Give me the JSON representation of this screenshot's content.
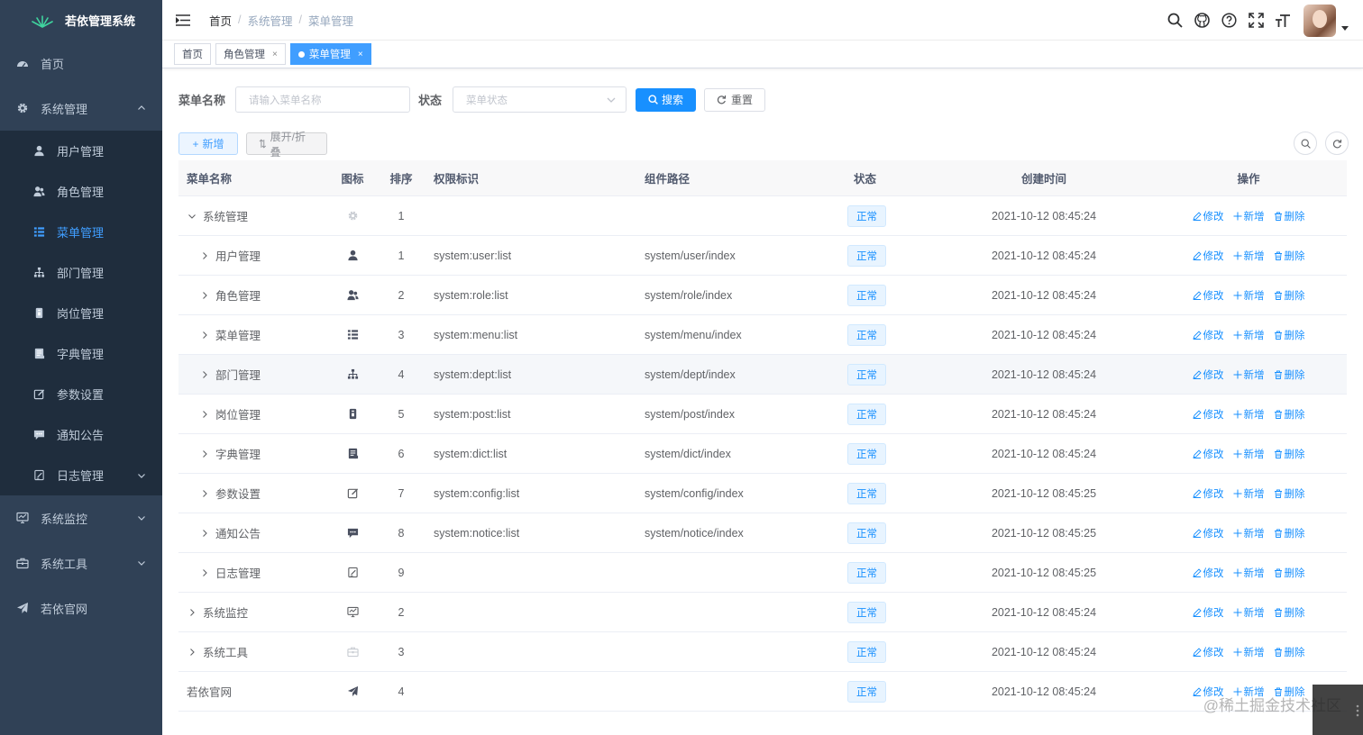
{
  "app": {
    "title": "若依管理系统"
  },
  "sidebar": {
    "top": [
      {
        "label": "首页",
        "icon": "dashboard-icon"
      },
      {
        "label": "系统管理",
        "icon": "gear-icon",
        "open": true
      }
    ],
    "sub": [
      {
        "label": "用户管理",
        "icon": "user-icon"
      },
      {
        "label": "角色管理",
        "icon": "peoples-icon"
      },
      {
        "label": "菜单管理",
        "icon": "tree-table-icon",
        "active": true
      },
      {
        "label": "部门管理",
        "icon": "tree-icon"
      },
      {
        "label": "岗位管理",
        "icon": "post-icon"
      },
      {
        "label": "字典管理",
        "icon": "dict-icon"
      },
      {
        "label": "参数设置",
        "icon": "edit-icon"
      },
      {
        "label": "通知公告",
        "icon": "message-icon"
      },
      {
        "label": "日志管理",
        "icon": "log-icon"
      }
    ],
    "bottom": [
      {
        "label": "系统监控",
        "icon": "monitor-icon"
      },
      {
        "label": "系统工具",
        "icon": "tool-icon"
      },
      {
        "label": "若依官网",
        "icon": "guide-icon"
      }
    ]
  },
  "breadcrumb": [
    "首页",
    "系统管理",
    "菜单管理"
  ],
  "tags": [
    {
      "label": "首页"
    },
    {
      "label": "角色管理",
      "closable": true
    },
    {
      "label": "菜单管理",
      "closable": true,
      "active": true
    }
  ],
  "search": {
    "name_label": "菜单名称",
    "name_placeholder": "请输入菜单名称",
    "status_label": "状态",
    "status_placeholder": "菜单状态",
    "search_btn": "搜索",
    "reset_btn": "重置"
  },
  "toolbar": {
    "add_btn": "新增",
    "expand_btn": "展开/折叠"
  },
  "table": {
    "headers": [
      "菜单名称",
      "图标",
      "排序",
      "权限标识",
      "组件路径",
      "状态",
      "创建时间",
      "操作"
    ],
    "ops": {
      "edit": "修改",
      "add": "新增",
      "delete": "删除"
    },
    "rows": [
      {
        "name": "系统管理",
        "level": 0,
        "expanded": true,
        "icon": "gear-icon",
        "order": "1",
        "perms": "",
        "component": "",
        "status": "正常",
        "time": "2021-10-12 08:45:24"
      },
      {
        "name": "用户管理",
        "level": 1,
        "icon": "user-icon",
        "order": "1",
        "perms": "system:user:list",
        "component": "system/user/index",
        "status": "正常",
        "time": "2021-10-12 08:45:24"
      },
      {
        "name": "角色管理",
        "level": 1,
        "icon": "peoples-icon",
        "order": "2",
        "perms": "system:role:list",
        "component": "system/role/index",
        "status": "正常",
        "time": "2021-10-12 08:45:24"
      },
      {
        "name": "菜单管理",
        "level": 1,
        "icon": "tree-table-icon",
        "order": "3",
        "perms": "system:menu:list",
        "component": "system/menu/index",
        "status": "正常",
        "time": "2021-10-12 08:45:24"
      },
      {
        "name": "部门管理",
        "level": 1,
        "icon": "tree-icon",
        "order": "4",
        "perms": "system:dept:list",
        "component": "system/dept/index",
        "status": "正常",
        "time": "2021-10-12 08:45:24",
        "hover": true
      },
      {
        "name": "岗位管理",
        "level": 1,
        "icon": "post-icon",
        "order": "5",
        "perms": "system:post:list",
        "component": "system/post/index",
        "status": "正常",
        "time": "2021-10-12 08:45:24"
      },
      {
        "name": "字典管理",
        "level": 1,
        "icon": "dict-icon",
        "order": "6",
        "perms": "system:dict:list",
        "component": "system/dict/index",
        "status": "正常",
        "time": "2021-10-12 08:45:24"
      },
      {
        "name": "参数设置",
        "level": 1,
        "icon": "edit-icon",
        "order": "7",
        "perms": "system:config:list",
        "component": "system/config/index",
        "status": "正常",
        "time": "2021-10-12 08:45:25"
      },
      {
        "name": "通知公告",
        "level": 1,
        "icon": "message-icon",
        "order": "8",
        "perms": "system:notice:list",
        "component": "system/notice/index",
        "status": "正常",
        "time": "2021-10-12 08:45:25"
      },
      {
        "name": "日志管理",
        "level": 1,
        "icon": "log-icon",
        "order": "9",
        "perms": "",
        "component": "",
        "status": "正常",
        "time": "2021-10-12 08:45:25"
      },
      {
        "name": "系统监控",
        "level": 0,
        "icon": "monitor-icon",
        "order": "2",
        "perms": "",
        "component": "",
        "status": "正常",
        "time": "2021-10-12 08:45:24"
      },
      {
        "name": "系统工具",
        "level": 0,
        "icon": "tool-icon",
        "order": "3",
        "perms": "",
        "component": "",
        "status": "正常",
        "time": "2021-10-12 08:45:24"
      },
      {
        "name": "若依官网",
        "level": 0,
        "leaf": true,
        "icon": "guide-icon",
        "order": "4",
        "perms": "",
        "component": "",
        "status": "正常",
        "time": "2021-10-12 08:45:24"
      }
    ]
  },
  "watermark": "@稀土掘金技术社区",
  "colors": {
    "sidebar_bg": "#304156",
    "submenu_bg": "#1f2d3d",
    "primary": "#1890ff",
    "active_menu": "#409eff"
  }
}
